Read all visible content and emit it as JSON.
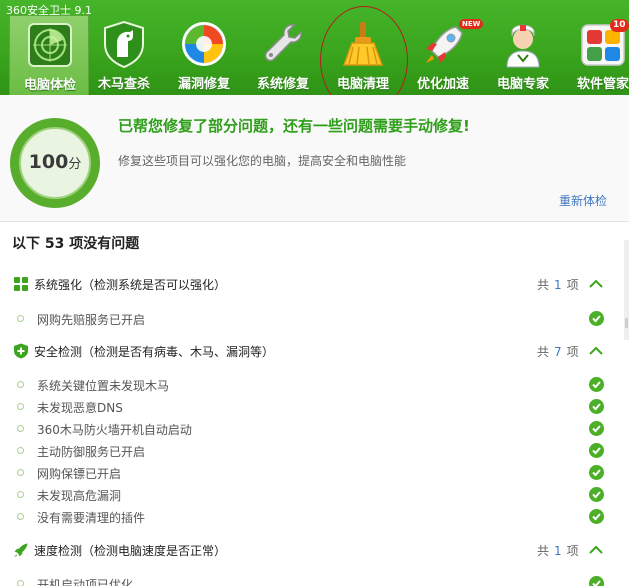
{
  "app": {
    "title": "360安全卫士 9.1"
  },
  "nav": [
    {
      "label": "电脑体检",
      "icon": "radar-icon"
    },
    {
      "label": "木马查杀",
      "icon": "horse-shield-icon"
    },
    {
      "label": "漏洞修复",
      "icon": "windows-patch-icon"
    },
    {
      "label": "系统修复",
      "icon": "wrench-icon"
    },
    {
      "label": "电脑清理",
      "icon": "broom-icon"
    },
    {
      "label": "优化加速",
      "icon": "rocket-icon",
      "badge": "NEW"
    },
    {
      "label": "电脑专家",
      "icon": "doctor-icon"
    },
    {
      "label": "软件管家",
      "icon": "software-grid-icon",
      "badge": "10"
    }
  ],
  "summary": {
    "score": "100",
    "score_unit": "分",
    "title": "已帮您修复了部分问题，还有一些问题需要手动修复!",
    "subtitle": "修复这些项目可以强化您的电脑，提高安全和电脑性能",
    "recheck": "重新体检"
  },
  "list_title": "以下 53 项没有问题",
  "categories": [
    {
      "icon": "windows-blocks-icon",
      "label": "系统强化（检测系统是否可以强化）",
      "count_prefix": "共",
      "count": "1",
      "count_suffix": "项",
      "items": [
        "网购先赔服务已开启"
      ]
    },
    {
      "icon": "shield-plus-icon",
      "label": "安全检测（检测是否有病毒、木马、漏洞等）",
      "count_prefix": "共",
      "count": "7",
      "count_suffix": "项",
      "items": [
        "系统关键位置未发现木马",
        "未发现恶意DNS",
        "360木马防火墙开机自动启动",
        "主动防御服务已开启",
        "网购保镖已开启",
        "未发现高危漏洞",
        "没有需要清理的插件"
      ]
    },
    {
      "icon": "speed-rocket-icon",
      "label": "速度检测（检测电脑速度是否正常）",
      "count_prefix": "共",
      "count": "1",
      "count_suffix": "项",
      "items": [
        "开机启动项已优化"
      ]
    }
  ],
  "colors": {
    "brand_green": "#3aa51d",
    "ok_green": "#4caf28",
    "link_blue": "#3e77c4",
    "annotation_red": "#b71c1c"
  }
}
